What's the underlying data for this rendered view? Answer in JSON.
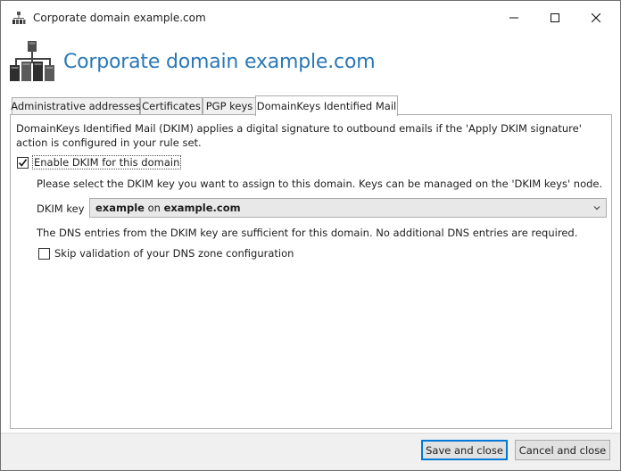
{
  "window": {
    "title": "Corporate domain example.com",
    "controls": {
      "minimize": "minimize",
      "maximize": "maximize",
      "close": "close"
    }
  },
  "header": {
    "title": "Corporate domain example.com",
    "icon": "domain-network-icon"
  },
  "tabs": [
    {
      "label": "Administrative addresses",
      "active": false
    },
    {
      "label": "Certificates",
      "active": false
    },
    {
      "label": "PGP keys",
      "active": false
    },
    {
      "label": "DomainKeys Identified Mail",
      "active": true
    }
  ],
  "dkim": {
    "description": "DomainKeys Identified Mail (DKIM) applies a digital signature to outbound emails if the 'Apply DKIM signature' action is configured in your rule set.",
    "enable_label": "Enable DKIM for this domain",
    "enable_checked": true,
    "select_prompt": "Please select the DKIM key you want to assign to this domain. Keys can be managed on the 'DKIM keys' node.",
    "key_label": "DKIM key",
    "key_selected": {
      "name": "example",
      "sep": "on",
      "domain": "example.com"
    },
    "dns_note": "The DNS entries from the DKIM key are sufficient for this domain. No additional DNS entries are required.",
    "skip_label": "Skip validation of your DNS zone configuration",
    "skip_checked": false
  },
  "buttons": {
    "save": "Save and close",
    "cancel": "Cancel and close"
  },
  "colors": {
    "header_title": "#2a78b7",
    "primary_border": "#0078d7"
  }
}
